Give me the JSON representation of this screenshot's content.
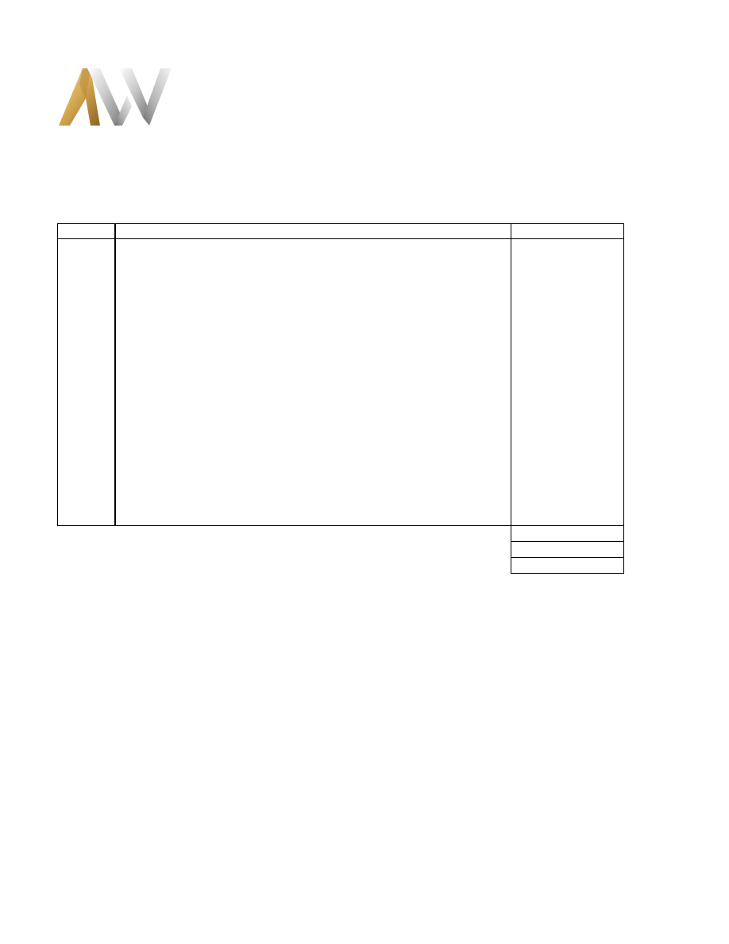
{
  "logo": {
    "icon": "aw-monogram-logo",
    "colors": {
      "gold_light": "#f3d79a",
      "gold_dark": "#a87a2a",
      "silver_light": "#f4f4f4",
      "silver_dark": "#8a8a8a"
    }
  },
  "table": {
    "header": {
      "qty": "",
      "description": "",
      "amount": ""
    },
    "body": {
      "qty": "",
      "description": "",
      "amount": ""
    },
    "summary": [
      "",
      "",
      ""
    ]
  }
}
